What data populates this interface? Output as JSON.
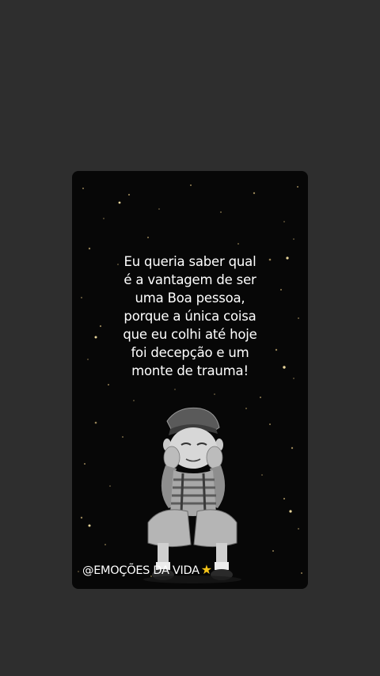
{
  "colors": {
    "page_background": "#2e2e2e",
    "card_background": "#070707",
    "text": "#ffffff",
    "star": "#f5c518"
  },
  "quote": {
    "lines": [
      "Eu queria saber qual",
      "é a vantagem de ser",
      "uma Boa pessoa,",
      "porque a única coisa",
      "que eu colhi até hoje",
      "foi decepção e um",
      "monte de trauma!"
    ]
  },
  "handle": {
    "text": "@EMOÇÕES DA VIDA",
    "icon": "star-icon"
  }
}
